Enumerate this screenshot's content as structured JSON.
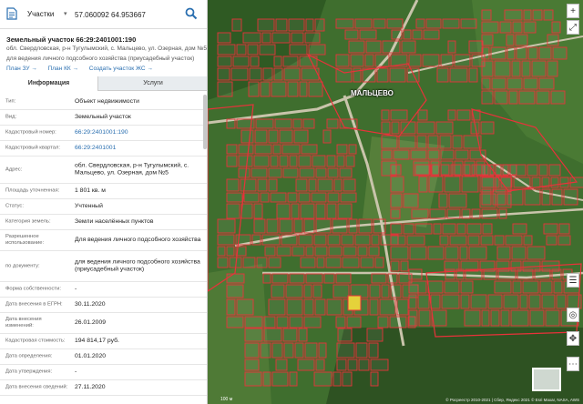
{
  "search": {
    "layer": "Участки",
    "query": "57.060092 64.953667"
  },
  "parcel": {
    "title": "Земельный участок 66:29:2401001:190",
    "address": "обл. Свердловская, р-н Тугулымский, с. Мальцево, ул. Озерная, дом №5",
    "purpose": "для ведения личного подсобного хозяйства (приусадебный участок)",
    "links": [
      "План ЗУ",
      "План КК",
      "Создать участок ЖС"
    ]
  },
  "tabs": [
    "Информация",
    "Услуги"
  ],
  "info_rows": [
    {
      "label": "Тип:",
      "value": "Объект недвижимости"
    },
    {
      "label": "Вид:",
      "value": "Земельный участок"
    },
    {
      "label": "Кадастровый номер:",
      "value": "66:29:2401001:190",
      "link": true
    },
    {
      "label": "Кадастровый квартал:",
      "value": "66:29:2401001",
      "link": true
    },
    {
      "label": "Адрес:",
      "value": "обл. Свердловская, р-н Тугулымский, с. Мальцево, ул. Озерная, дом №5"
    },
    {
      "label": "Площадь уточненная:",
      "value": "1 801 кв. м"
    },
    {
      "label": "Статус:",
      "value": "Учтенный"
    },
    {
      "label": "Категория земель:",
      "value": "Земли населённых пунктов"
    },
    {
      "label": "Разрешенное использование:",
      "value": "Для ведения личного подсобного хозяйства"
    },
    {
      "label": "по документу:",
      "value": "для ведения личного подсобного хозяйства (приусадебный участок)"
    },
    {
      "label": "Форма собственности:",
      "value": "-"
    },
    {
      "label": "Дата внесения в ЕГРН:",
      "value": "30.11.2020"
    },
    {
      "label": "Дата внесения изменений:",
      "value": "26.01.2009"
    },
    {
      "label": "Кадастровая стоимость:",
      "value": "194 814,17 руб."
    },
    {
      "label": "Дата определения:",
      "value": "01.01.2020"
    },
    {
      "label": "Дата утверждения:",
      "value": "-"
    },
    {
      "label": "Дата внесения сведений:",
      "value": "27.11.2020"
    }
  ],
  "map": {
    "village": "МАЛЬЦЕВО",
    "scale": "100 м",
    "copyright": "© Росреестр 2010-2021 | Сбер, Яндекс 2021 © Esri Maxar, NASA, AWS"
  },
  "colors": {
    "accent": "#2a6fb0",
    "parcel_border": "#e8323a",
    "selected_parcel": "#e5d23a"
  }
}
